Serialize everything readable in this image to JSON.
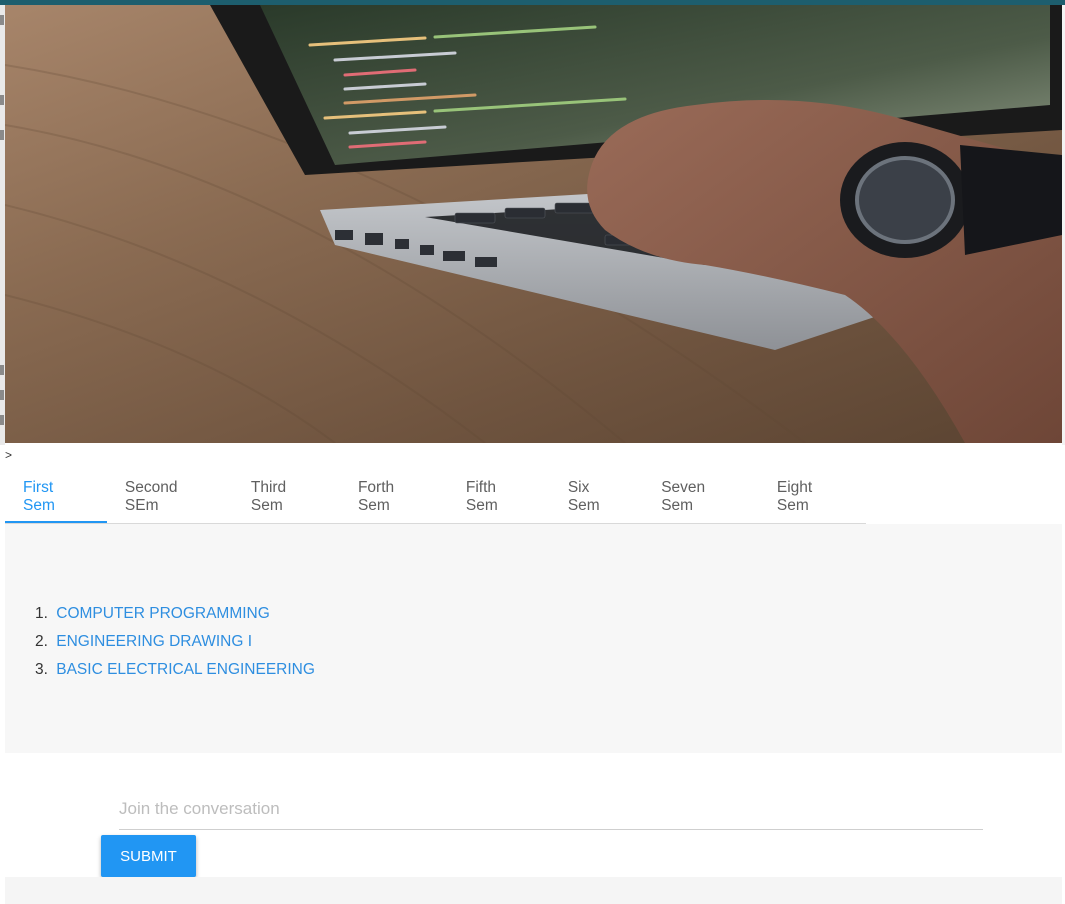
{
  "header_caret": ">",
  "tabs": [
    {
      "label": "First Sem"
    },
    {
      "label": "Second SEm"
    },
    {
      "label": "Third Sem"
    },
    {
      "label": "Forth Sem"
    },
    {
      "label": "Fifth Sem"
    },
    {
      "label": "Six Sem"
    },
    {
      "label": "Seven Sem"
    },
    {
      "label": "Eight Sem"
    }
  ],
  "active_tab": "First Sem",
  "subjects": [
    {
      "num": "1.",
      "name": "Computer Programming"
    },
    {
      "num": "2.",
      "name": "Engineering Drawing I"
    },
    {
      "num": "3.",
      "name": "Basic Electrical Engineering"
    }
  ],
  "comment": {
    "placeholder": "Join the conversation",
    "value": "",
    "submit_label": "SUBMIT"
  },
  "colors": {
    "accent": "#2196f3",
    "link": "#2e8ee0",
    "top_strip": "#1d5e6e"
  }
}
